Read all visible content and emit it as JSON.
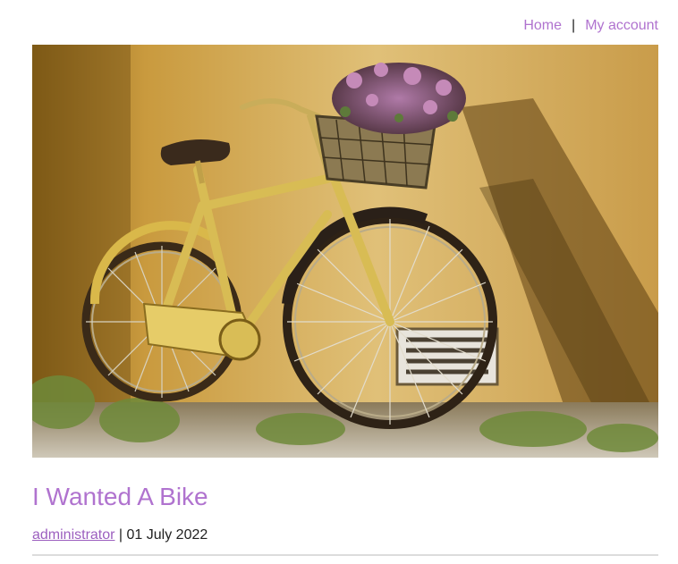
{
  "nav": {
    "home_label": "Home",
    "separator": "|",
    "account_label": "My account"
  },
  "hero": {
    "alt": "Yellow vintage bicycle with a flower basket leaning against a wall"
  },
  "post": {
    "title": "I Wanted A Bike",
    "author": "administrator",
    "meta_separator": " | ",
    "date": "01 July 2022"
  },
  "colors": {
    "accent": "#b073cf",
    "text": "#222222",
    "divider": "#dcdcdc"
  }
}
